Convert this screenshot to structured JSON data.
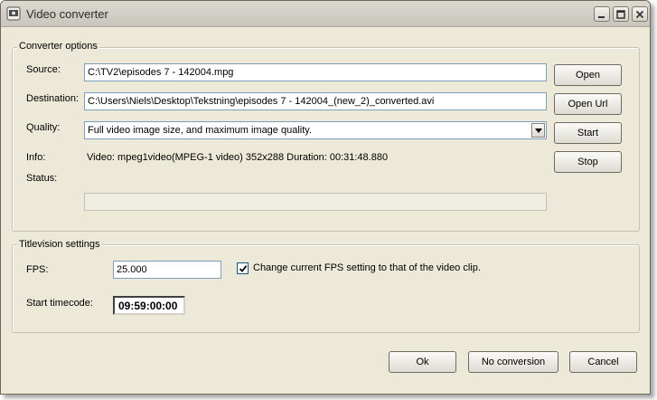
{
  "window": {
    "title": "Video converter"
  },
  "converter_options": {
    "legend": "Converter options",
    "source_label": "Source:",
    "source_value": "C:\\TV2\\episodes 7 - 142004.mpg",
    "destination_label": "Destination:",
    "destination_value": "C:\\Users\\Niels\\Desktop\\Tekstning\\episodes 7 - 142004_(new_2)_converted.avi",
    "quality_label": "Quality:",
    "quality_value": "Full video image size, and maximum image quality.",
    "info_label": "Info:",
    "info_value": "Video: mpeg1video(MPEG-1 video) 352x288 Duration: 00:31:48.880",
    "status_label": "Status:",
    "buttons": {
      "open": "Open",
      "open_url": "Open Url",
      "start": "Start",
      "stop": "Stop"
    }
  },
  "titlevision_settings": {
    "legend": "Titlevision settings",
    "fps_label": "FPS:",
    "fps_value": "25.000",
    "change_fps_checked": true,
    "change_fps_label": "Change current FPS setting to that of the video clip.",
    "start_timecode_label": "Start timecode:",
    "start_timecode_value": "09:59:00:00"
  },
  "footer": {
    "ok": "Ok",
    "no_conversion": "No conversion",
    "cancel": "Cancel"
  },
  "colors": {
    "dialog_bg": "#ece9d8",
    "field_border": "#7f9db9"
  }
}
